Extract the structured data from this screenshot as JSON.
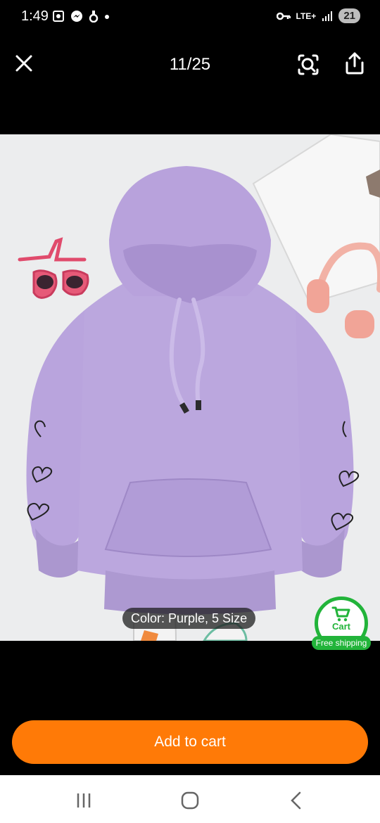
{
  "status_bar": {
    "time": "1:49",
    "network": "LTE+",
    "battery": "21"
  },
  "header": {
    "counter": "11/25"
  },
  "photo": {
    "variant_chip": "Color: Purple, 5 Size"
  },
  "cart_badge": {
    "label": "Cart",
    "free_shipping": "Free shipping"
  },
  "footer": {
    "add_to_cart": "Add to cart"
  },
  "colors": {
    "accent": "#ff7a07",
    "cart_green": "#22b43a",
    "hoodie": "#b9a4dd"
  }
}
